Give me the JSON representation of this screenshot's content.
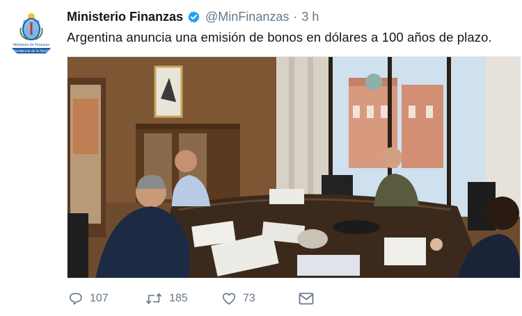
{
  "tweet": {
    "display_name": "Ministerio Finanzas",
    "handle": "@MinFinanzas",
    "separator": "·",
    "time": "3 h",
    "text": "Argentina anuncia una emisión de bonos en dólares a 100 años de plazo.",
    "avatar": {
      "line1": "Ministerio de Finanzas",
      "line2": "Presidencia de la Nación"
    }
  },
  "actions": {
    "reply_count": "107",
    "retweet_count": "185",
    "like_count": "73"
  },
  "colors": {
    "text": "#14171a",
    "muted": "#657786",
    "verified": "#1da1f2",
    "avatar_blue": "#1f5fa8"
  },
  "icons": [
    "verified-badge-icon",
    "reply-icon",
    "retweet-icon",
    "like-icon",
    "direct-message-icon"
  ]
}
